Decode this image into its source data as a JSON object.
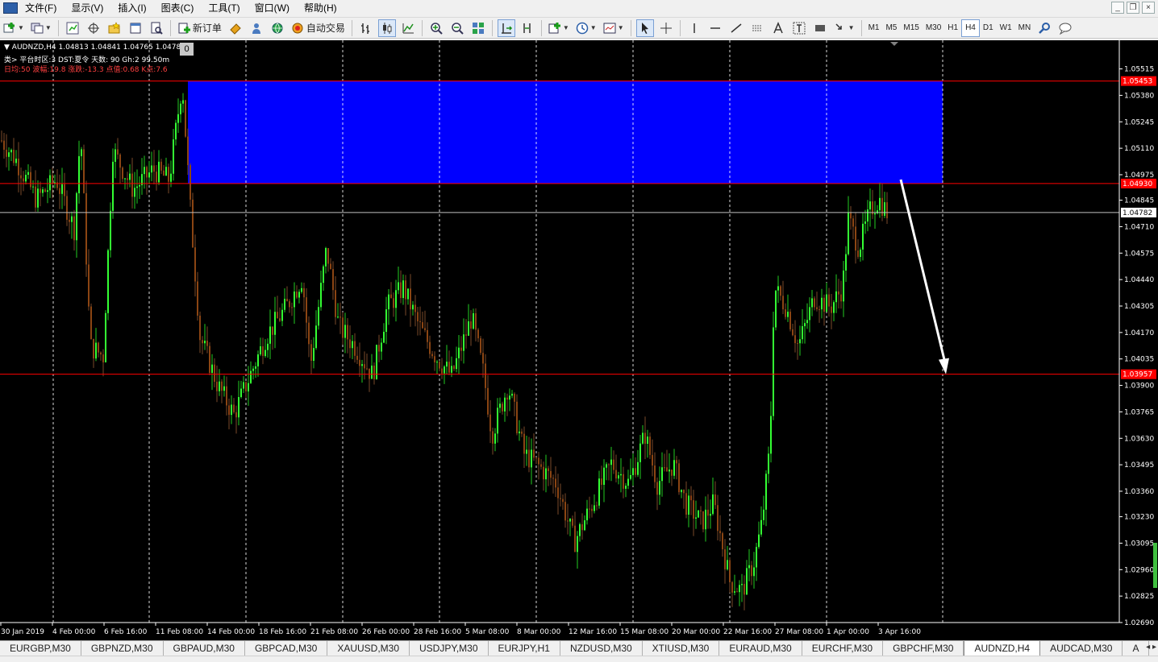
{
  "menu": [
    "文件(F)",
    "显示(V)",
    "插入(I)",
    "图表(C)",
    "工具(T)",
    "窗口(W)",
    "帮助(H)"
  ],
  "window_buttons": [
    "_",
    "❐",
    "×"
  ],
  "toolbar": {
    "new_order_label": "新订单",
    "auto_trading_label": "自动交易",
    "timeframes": [
      "M1",
      "M5",
      "M15",
      "M30",
      "H1",
      "H4",
      "D1",
      "W1",
      "MN"
    ],
    "active_timeframe": "H4"
  },
  "chart": {
    "symbol_line": "AUDNZD,H4  1.04813 1.04841 1.04765 1.04782",
    "info_line2": "类> 平台时区:3  DST:夏令 天数: 90  Gh:2  99.50m",
    "info_line3": "日均:50  波幅:19.8  涨跌:-13.3  点值:0.68  K点:7.6",
    "zero_badge": "0",
    "background": "#000000",
    "bull_color": "#33ff33",
    "bear_color": "#8b4513",
    "supply_zone_color": "#0000ff",
    "level_line_color": "#ff0000"
  },
  "chart_data": {
    "type": "candlestick",
    "symbol": "AUDNZD",
    "timeframe": "H4",
    "ylim": [
      1.0269,
      1.0562
    ],
    "y_ticks": [
      "1.05515",
      "1.05380",
      "1.05245",
      "1.05110",
      "1.04975",
      "1.04845",
      "1.04710",
      "1.04575",
      "1.04440",
      "1.04305",
      "1.04170",
      "1.04035",
      "1.03900",
      "1.03765",
      "1.03630",
      "1.03495",
      "1.03360",
      "1.03230",
      "1.03095",
      "1.02960",
      "1.02825",
      "1.02690"
    ],
    "x_ticks": [
      "30 Jan 2019",
      "4 Feb 00:00",
      "6 Feb 16:00",
      "11 Feb 08:00",
      "14 Feb 00:00",
      "18 Feb 16:00",
      "21 Feb 08:00",
      "26 Feb 00:00",
      "28 Feb 16:00",
      "5 Mar 08:00",
      "8 Mar 00:00",
      "12 Mar 16:00",
      "15 Mar 08:00",
      "20 Mar 00:00",
      "22 Mar 16:00",
      "27 Mar 08:00",
      "1 Apr 00:00",
      "3 Apr 16:00"
    ],
    "levels": [
      {
        "price": 1.05453,
        "label": "1.05453",
        "style": "red"
      },
      {
        "price": 1.0493,
        "label": "1.04930",
        "style": "red"
      },
      {
        "price": 1.04782,
        "label": "1.04782",
        "style": "current"
      },
      {
        "price": 1.03957,
        "label": "1.03957",
        "style": "red"
      }
    ],
    "zone": {
      "from": 1.0493,
      "to": 1.05453
    },
    "arrow": {
      "from_price": 1.04975,
      "to_price": 1.03957
    }
  },
  "tabs": [
    "EURGBP,M30",
    "GBPNZD,M30",
    "GBPAUD,M30",
    "GBPCAD,M30",
    "XAUUSD,M30",
    "USDJPY,M30",
    "EURJPY,H1",
    "NZDUSD,M30",
    "XTIUSD,M30",
    "EURAUD,M30",
    "EURCHF,M30",
    "GBPCHF,M30",
    "AUDNZD,H4",
    "AUDCAD,M30",
    "A"
  ],
  "active_tab": "AUDNZD,H4",
  "tab_arrows": "◂ ▸"
}
